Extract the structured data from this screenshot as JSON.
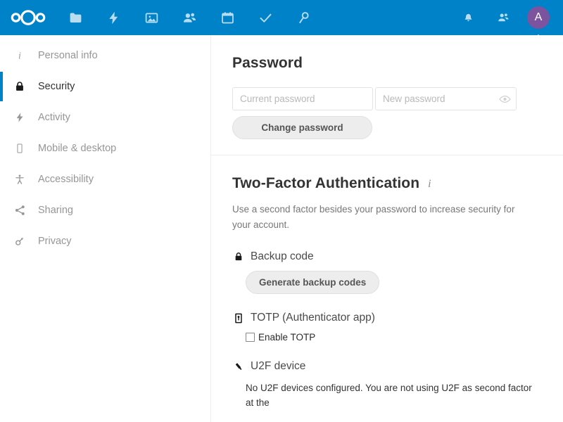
{
  "header": {
    "logo_name": "nextcloud-logo",
    "background_color": "#0082c9",
    "app_icons": [
      {
        "name": "files-icon",
        "label": "Files"
      },
      {
        "name": "activity-icon",
        "label": "Activity"
      },
      {
        "name": "photos-icon",
        "label": "Photos"
      },
      {
        "name": "contacts-icon",
        "label": "Contacts"
      },
      {
        "name": "calendar-icon",
        "label": "Calendar"
      },
      {
        "name": "tasks-icon",
        "label": "Tasks"
      },
      {
        "name": "passwords-icon",
        "label": "Passwords"
      }
    ],
    "right_icons": [
      {
        "name": "notifications-bell-icon",
        "label": "Notifications"
      },
      {
        "name": "contacts-menu-icon",
        "label": "Contacts"
      }
    ],
    "avatar": {
      "initial": "A",
      "color": "#7b539e"
    }
  },
  "sidebar": {
    "items": [
      {
        "label": "Personal info",
        "icon": "info-icon",
        "active": false
      },
      {
        "label": "Security",
        "icon": "lock-icon",
        "active": true
      },
      {
        "label": "Activity",
        "icon": "lightning-icon",
        "active": false
      },
      {
        "label": "Mobile & desktop",
        "icon": "mobile-icon",
        "active": false
      },
      {
        "label": "Accessibility",
        "icon": "accessibility-icon",
        "active": false
      },
      {
        "label": "Sharing",
        "icon": "share-icon",
        "active": false
      },
      {
        "label": "Privacy",
        "icon": "key-icon",
        "active": false
      }
    ],
    "active_indicator_color": "#0082c9"
  },
  "password_section": {
    "title": "Password",
    "current_password": {
      "value": "",
      "placeholder": "Current password"
    },
    "new_password": {
      "value": "",
      "placeholder": "New password"
    },
    "show_password_icon": "eye-icon",
    "change_button_label": "Change password"
  },
  "two_factor_section": {
    "title": "Two-Factor Authentication",
    "info_icon": "info-icon",
    "description": "Use a second factor besides your password to increase security for your account.",
    "providers": [
      {
        "name": "Backup code",
        "icon": "lock-icon",
        "button_label": "Generate backup codes"
      },
      {
        "name": "TOTP (Authenticator app)",
        "icon": "totp-token-icon",
        "checkbox_label": "Enable TOTP",
        "checkbox_checked": false
      },
      {
        "name": "U2F device",
        "icon": "usb-key-icon",
        "body_text": "No U2F devices configured. You are not using U2F as second factor at the"
      }
    ]
  }
}
